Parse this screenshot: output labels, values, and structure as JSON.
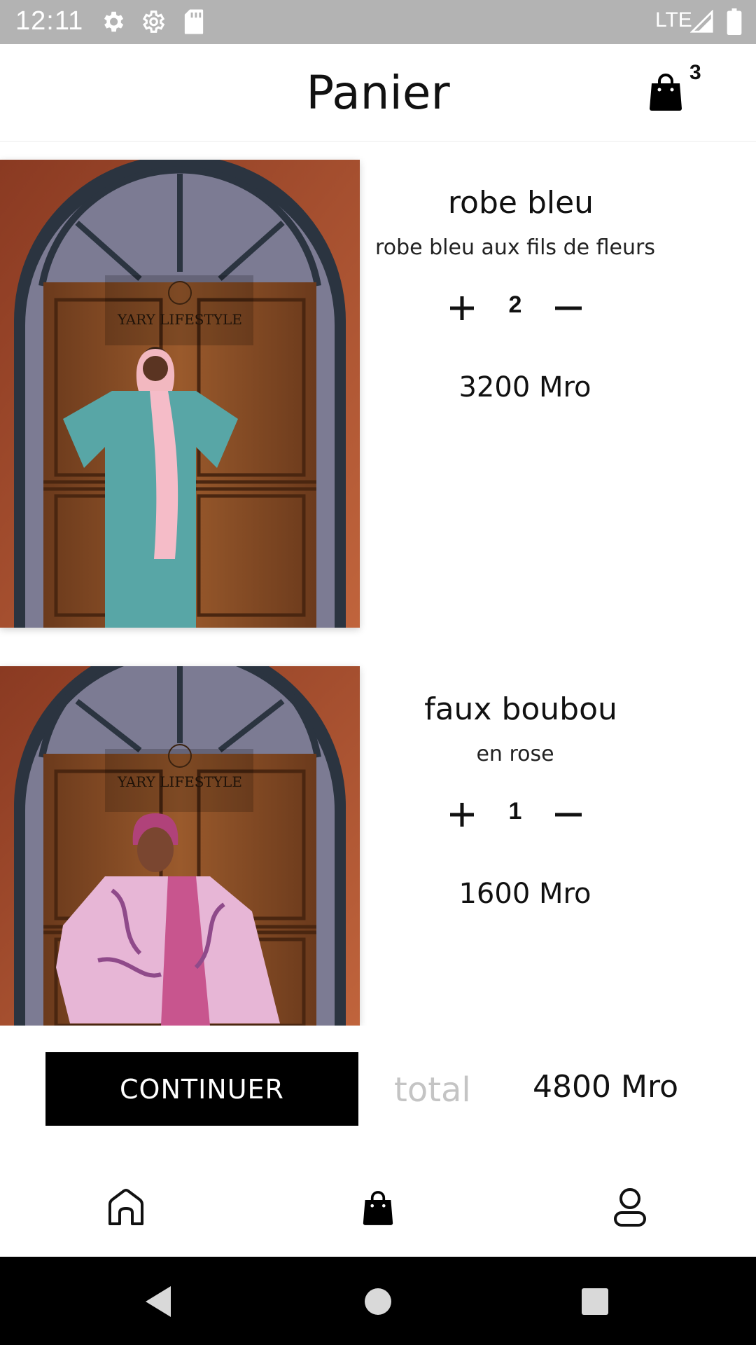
{
  "status_bar": {
    "time": "12:11",
    "network": "LTE",
    "icons": [
      "settings-icon",
      "settings-outline-icon",
      "sd-card-icon",
      "signal-icon",
      "battery-icon"
    ]
  },
  "header": {
    "title": "Panier",
    "cart_count": "3",
    "cart_icon": "shopping-bag-icon"
  },
  "cart": {
    "items": [
      {
        "name": "robe bleu",
        "description": "robe bleu aux fils de fleurs",
        "quantity": "2",
        "price": "3200 Mro",
        "image_text": "YARY LIFESTYLE"
      },
      {
        "name": "faux boubou",
        "description": "en rose",
        "quantity": "1",
        "price": "1600 Mro",
        "image_text": "YARY LIFESTYLE"
      }
    ]
  },
  "footer": {
    "continue_label": "CONTINUER",
    "total_label": "total",
    "total_value": "4800 Mro"
  },
  "bottom_nav": {
    "items": [
      "home-icon",
      "shopping-bag-icon",
      "profile-icon"
    ]
  },
  "system_nav": {
    "items": [
      "back-icon",
      "home-circle-icon",
      "recents-icon"
    ]
  },
  "colors": {
    "status_bar": "#b3b3b3",
    "primary_button": "#000000",
    "total_label": "#c4c4c4"
  }
}
